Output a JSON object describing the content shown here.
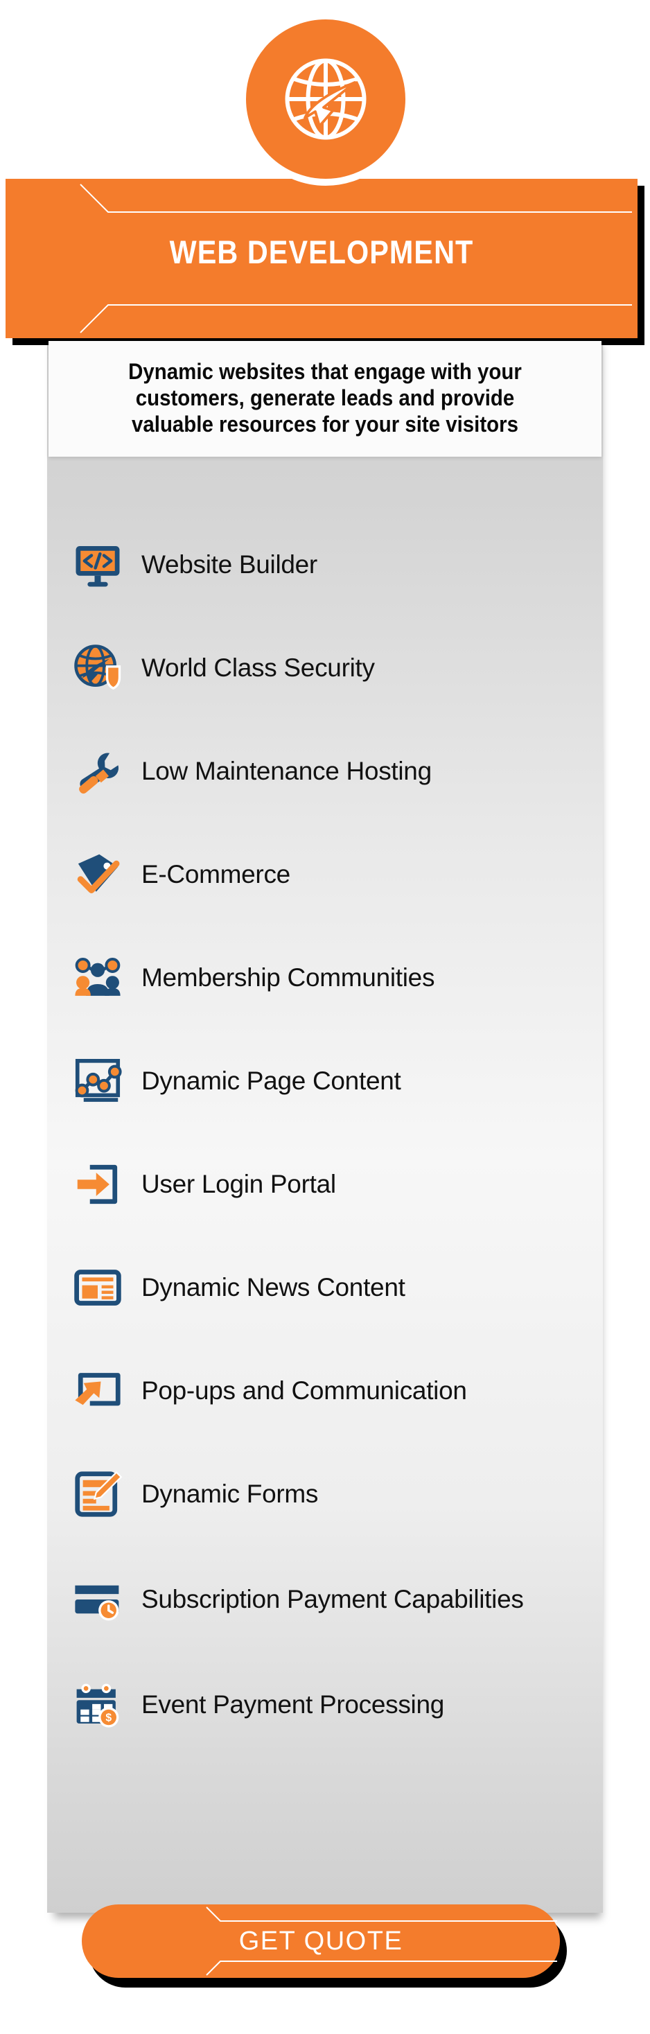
{
  "emblem": {
    "icon": "globe-arrow-icon",
    "bg_color": "#F47C2C"
  },
  "header": {
    "title": "WEB DEVELOPMENT",
    "bg_color": "#F47C2C",
    "text_color": "#FFFFFF"
  },
  "description": {
    "text": "Dynamic websites that engage with your customers, generate leads and provide valuable resources for your site visitors"
  },
  "features": [
    {
      "icon": "monitor-code-icon",
      "label": "Website Builder"
    },
    {
      "icon": "globe-shield-icon",
      "label": "World Class Security"
    },
    {
      "icon": "wrench-screwdriver-icon",
      "label": "Low Maintenance Hosting"
    },
    {
      "icon": "price-tag-icon",
      "label": "E-Commerce"
    },
    {
      "icon": "people-group-icon",
      "label": "Membership Communities"
    },
    {
      "icon": "chart-nodes-icon",
      "label": "Dynamic Page Content"
    },
    {
      "icon": "login-arrow-icon",
      "label": "User Login Portal"
    },
    {
      "icon": "newspaper-icon",
      "label": "Dynamic News Content"
    },
    {
      "icon": "popup-arrow-icon",
      "label": "Pop-ups and Communication"
    },
    {
      "icon": "form-pencil-icon",
      "label": "Dynamic Forms"
    },
    {
      "icon": "card-clock-icon",
      "label": "Subscription Payment Capabilities"
    },
    {
      "icon": "calendar-dollar-icon",
      "label": "Event Payment Processing"
    }
  ],
  "cta": {
    "label": "GET QUOTE",
    "bg_color": "#F47C2C",
    "text_color": "#FFFFFF"
  },
  "palette": {
    "orange": "#F47C2C",
    "navy": "#23527C",
    "icon_navy": "#1F4E79",
    "card_light": "#F7F7F7",
    "card_gray": "#CFCFCF"
  }
}
